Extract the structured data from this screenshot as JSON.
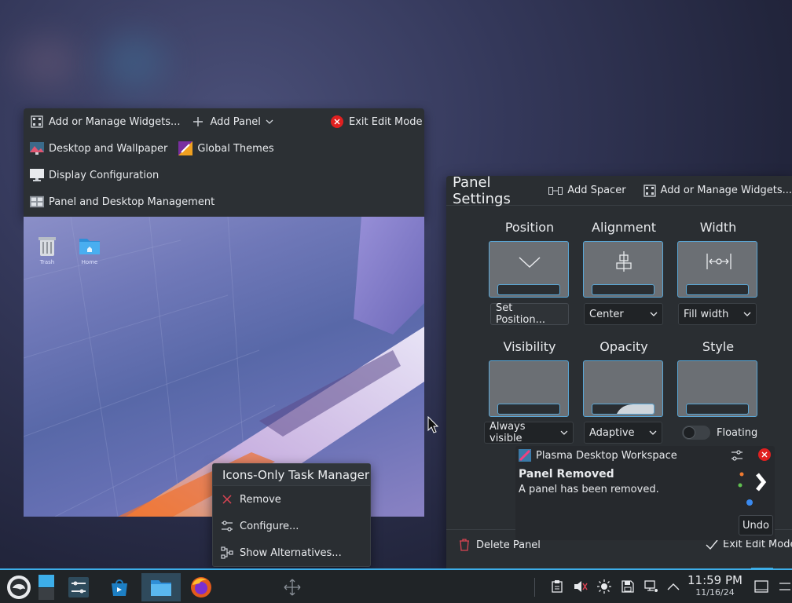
{
  "edit_toolbar": {
    "add_widgets": "Add or Manage Widgets...",
    "add_panel": "Add Panel",
    "exit_edit_mode": "Exit Edit Mode",
    "desktop_wallpaper": "Desktop and Wallpaper",
    "global_themes": "Global Themes",
    "display_config": "Display Configuration",
    "panel_desktop_mgmt": "Panel and Desktop Management"
  },
  "desktop_icons": [
    {
      "label": "Trash",
      "icon": "trash-icon"
    },
    {
      "label": "Home",
      "icon": "folder-home-icon"
    }
  ],
  "panel_settings": {
    "title": "Panel Settings",
    "add_spacer": "Add Spacer",
    "add_widgets": "Add or Manage Widgets...",
    "position_label": "Position",
    "alignment_label": "Alignment",
    "width_label": "Width",
    "visibility_label": "Visibility",
    "opacity_label": "Opacity",
    "style_label": "Style",
    "set_position": "Set Position...",
    "alignment_value": "Center",
    "width_value": "Fill width",
    "visibility_value": "Always visible",
    "opacity_value": "Adaptive",
    "floating_label": "Floating",
    "floating_on": false,
    "delete_panel": "Delete Panel",
    "exit_edit_mode": "Exit Edit Mode"
  },
  "notification": {
    "app_name": "Plasma Desktop Workspace",
    "title": "Panel Removed",
    "body": "A panel has been removed.",
    "undo": "Undo"
  },
  "context_menu": {
    "title": "Icons-Only Task Manager",
    "remove": "Remove",
    "configure": "Configure...",
    "alternatives": "Show Alternatives..."
  },
  "taskbar": {
    "time": "11:59 PM",
    "date": "11/16/24"
  },
  "colors": {
    "accent": "#3daee9",
    "danger": "#da4453",
    "panel_bg": "#2a2e32"
  }
}
